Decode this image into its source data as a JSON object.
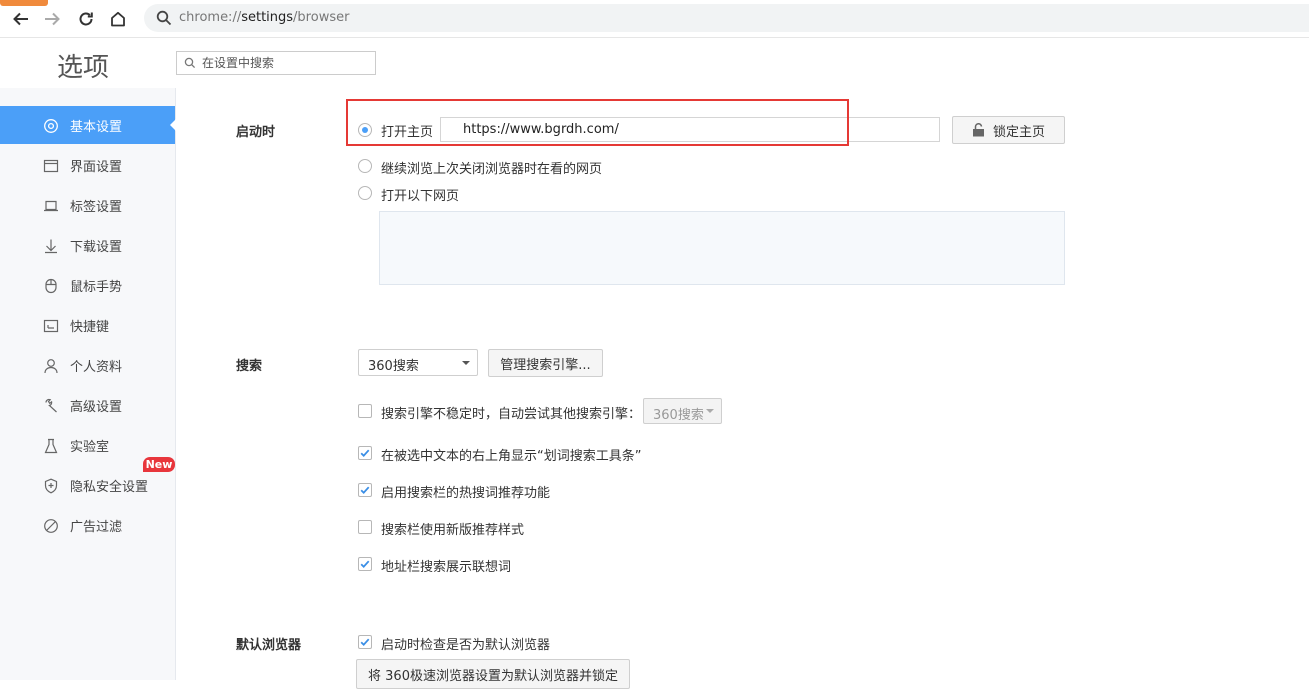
{
  "browser": {
    "badge_text": "",
    "address": {
      "scheme": "chrome://",
      "host": "settings",
      "path": "/browser"
    }
  },
  "header": {
    "title": "选项",
    "search_placeholder": "在设置中搜索"
  },
  "sidebar": {
    "items": [
      {
        "label": "基本设置",
        "icon": "settings-icon",
        "active": true
      },
      {
        "label": "界面设置",
        "icon": "window-icon"
      },
      {
        "label": "标签设置",
        "icon": "tab-icon"
      },
      {
        "label": "下载设置",
        "icon": "download-icon"
      },
      {
        "label": "鼠标手势",
        "icon": "mouse-icon"
      },
      {
        "label": "快捷键",
        "icon": "shortcut-icon"
      },
      {
        "label": "个人资料",
        "icon": "person-icon"
      },
      {
        "label": "高级设置",
        "icon": "wrench-icon"
      },
      {
        "label": "实验室",
        "icon": "flask-icon"
      },
      {
        "label": "隐私安全设置",
        "icon": "shield-icon"
      },
      {
        "label": "广告过滤",
        "icon": "block-icon"
      }
    ],
    "new_badge": "New",
    "accent": "#4b9ff8"
  },
  "startup": {
    "label": "启动时",
    "option_home": "打开主页",
    "home_url": "https://www.bgrdh.com/",
    "lock_button": "锁定主页",
    "option_continue": "继续浏览上次关闭浏览器时在看的网页",
    "option_pages": "打开以下网页"
  },
  "search": {
    "label": "搜索",
    "engine": "360搜索",
    "manage_button": "管理搜索引擎...",
    "fallback_text": "搜索引擎不稳定时，自动尝试其他搜索引擎：",
    "fallback_engine": "360搜索",
    "opt_toolbar": "在被选中文本的右上角显示“划词搜索工具条”",
    "opt_hotwords": "启用搜索栏的热搜词推荐功能",
    "opt_newstyle": "搜索栏使用新版推荐样式",
    "opt_suggest": "地址栏搜索展示联想词"
  },
  "default_browser": {
    "label": "默认浏览器",
    "opt_check": "启动时检查是否为默认浏览器",
    "set_button": "将 360极速浏览器设置为默认浏览器并锁定"
  }
}
